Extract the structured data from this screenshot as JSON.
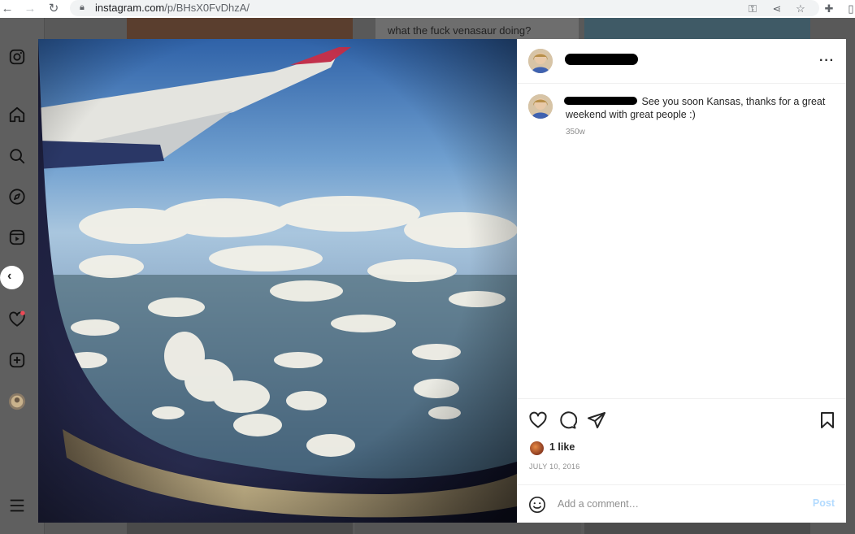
{
  "browser": {
    "url_host": "instagram.com",
    "url_path": "/p/BHsX0FvDhzA/"
  },
  "background": {
    "caption": "what the fuck venasaur doing?"
  },
  "post": {
    "caption_text": "See you soon Kansas, thanks for a great weekend with great people :)",
    "time_ago": "350w",
    "likes": "1 like",
    "date": "JULY 10, 2016"
  },
  "comment": {
    "placeholder": "Add a comment…",
    "post_label": "Post"
  },
  "icons": {
    "back": "back-arrow-icon",
    "forward": "forward-arrow-icon",
    "reload": "reload-icon",
    "lock": "lock-icon",
    "key": "key-icon",
    "share": "share-icon",
    "star": "star-icon",
    "extensions": "puzzle-icon",
    "more": "more-dots-icon"
  },
  "colors": {
    "post_button": "#b3dbff",
    "notification_dot": "#ed4956"
  }
}
